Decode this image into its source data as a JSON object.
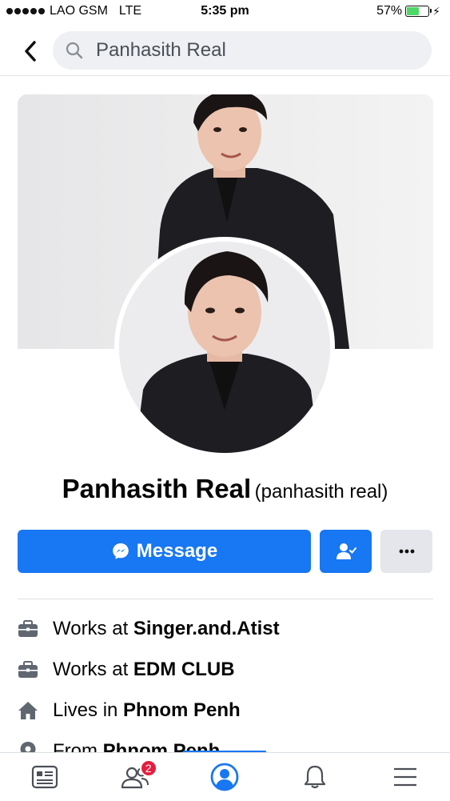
{
  "status_bar": {
    "carrier": "LAO GSM",
    "network": "LTE",
    "time": "5:35 pm",
    "battery": "57%",
    "battery_level": 0.57
  },
  "header": {
    "search_text": "Panhasith Real"
  },
  "profile": {
    "name": "Panhasith Real",
    "alternate_name": "(panhasith real)"
  },
  "actions": {
    "message_label": "Message"
  },
  "intro": {
    "items": [
      {
        "icon": "briefcase-icon",
        "prefix": "Works at ",
        "value": "Singer.and.Atist"
      },
      {
        "icon": "briefcase-icon",
        "prefix": "Works at ",
        "value": "EDM CLUB"
      },
      {
        "icon": "home-icon",
        "prefix": "Lives in ",
        "value": "Phnom Penh"
      },
      {
        "icon": "location-pin-icon",
        "prefix": "From ",
        "value": "Phnom Penh"
      }
    ]
  },
  "tab_bar": {
    "friends_badge": "2"
  },
  "colors": {
    "accent": "#1877f2",
    "badge": "#e41e3f",
    "battery": "#4cd964"
  }
}
